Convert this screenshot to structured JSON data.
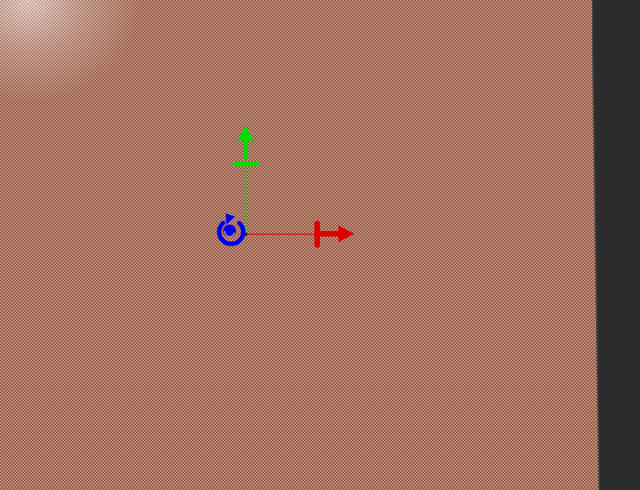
{
  "viewport": {
    "gizmo": {
      "mode": "translate-rotate",
      "axes": {
        "x": {
          "color": "#e00000",
          "handle": "arrow-right-icon"
        },
        "y": {
          "color": "#00dd00",
          "handle": "arrow-up-icon"
        },
        "rotate": {
          "color": "#0000ee",
          "handle": "rotate-icon"
        }
      }
    },
    "surface_color": "#c98f78"
  }
}
